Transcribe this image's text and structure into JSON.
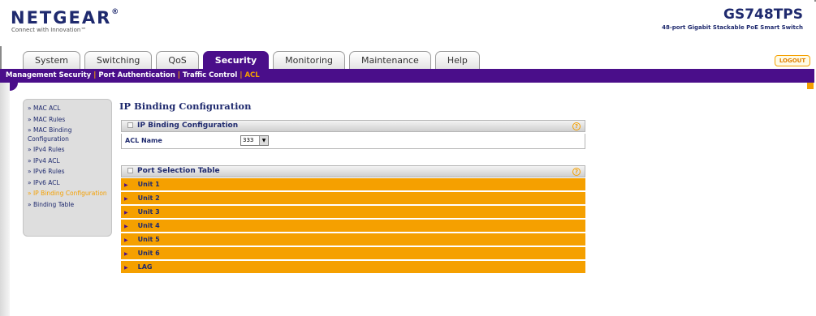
{
  "header": {
    "brand": "NETGEAR",
    "brand_mark": "®",
    "tagline": "Connect with Innovation™",
    "model": "GS748TPS",
    "model_desc": "48-port Gigabit Stackable PoE Smart Switch"
  },
  "tabs": [
    {
      "label": "System"
    },
    {
      "label": "Switching"
    },
    {
      "label": "QoS"
    },
    {
      "label": "Security",
      "active": true
    },
    {
      "label": "Monitoring"
    },
    {
      "label": "Maintenance"
    },
    {
      "label": "Help"
    }
  ],
  "logout_label": "LOGOUT",
  "subnav": {
    "items": [
      "Management Security",
      "Port Authentication",
      "Traffic Control",
      "ACL"
    ],
    "separator": "|",
    "active": "ACL"
  },
  "sidebar": {
    "items": [
      "» MAC ACL",
      "» MAC Rules",
      "» MAC Binding Configuration",
      "» IPv4 Rules",
      "» IPv4 ACL",
      "» IPv6 Rules",
      "» IPv6 ACL",
      "» IP Binding Configuration",
      "» Binding Table"
    ],
    "active_index": 7
  },
  "main": {
    "page_title": "IP Binding Configuration",
    "config_panel_title": "IP Binding Configuration",
    "acl_name_label": "ACL Name",
    "acl_name_value": "333",
    "port_panel_title": "Port Selection Table",
    "help_glyph": "?",
    "units": [
      "Unit 1",
      "Unit 2",
      "Unit 3",
      "Unit 4",
      "Unit 5",
      "Unit 6",
      "LAG"
    ]
  },
  "colors": {
    "purple": "#4a0e8a",
    "orange": "#f5a000",
    "navy": "#1f2a6e"
  }
}
